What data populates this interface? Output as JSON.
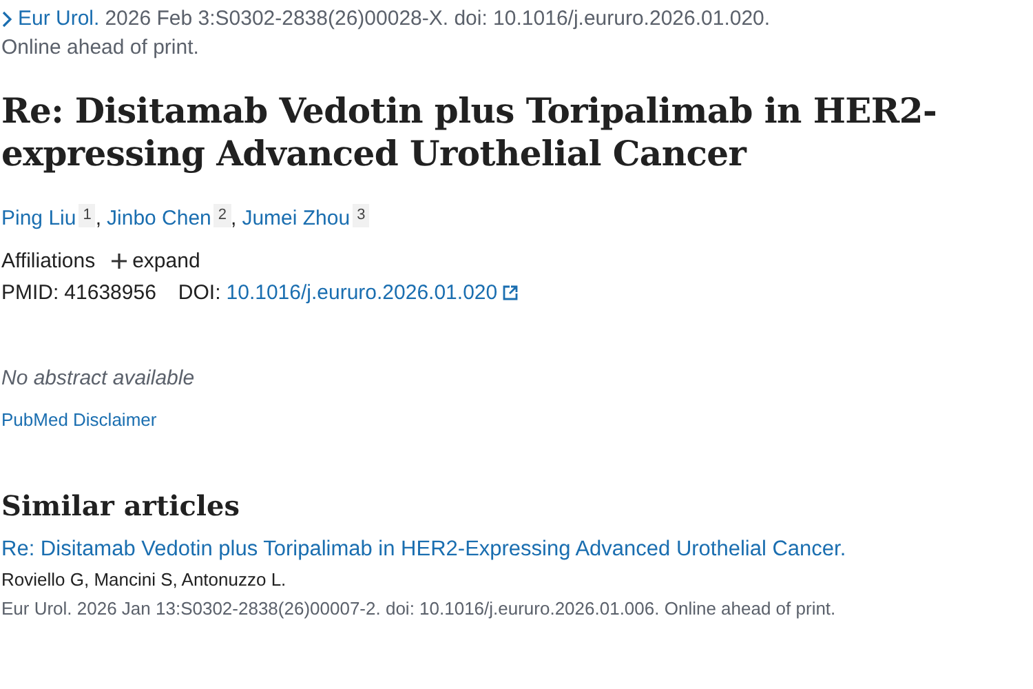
{
  "citation": {
    "journal": "Eur Urol.",
    "details": "2026 Feb 3:S0302-2838(26)00028-X. doi: 10.1016/j.eururo.2026.01.020.",
    "status": "Online ahead of print."
  },
  "title": "Re: Disitamab Vedotin plus Toripalimab in HER2-expressing Advanced Urothelial Cancer",
  "authors": [
    {
      "name": "Ping Liu",
      "affiliation": "1"
    },
    {
      "separator": ",",
      "name": "Jinbo Chen",
      "affiliation": "2"
    },
    {
      "separator": ",",
      "name": "Jumei Zhou",
      "affiliation": "3"
    }
  ],
  "affiliations": {
    "label": "Affiliations",
    "toggle": "expand",
    "expanded": false
  },
  "identifiers": {
    "pmid_label": "PMID:",
    "pmid": "41638956",
    "doi_label": "DOI:",
    "doi": "10.1016/j.eururo.2026.01.020"
  },
  "abstract": "No abstract available",
  "disclaimer": "PubMed Disclaimer",
  "similar_articles": {
    "heading": "Similar articles",
    "items": [
      {
        "title": "Re: Disitamab Vedotin plus Toripalimab in HER2-Expressing Advanced Urothelial Cancer.",
        "authors": "Roviello G, Mancini S, Antonuzzo L.",
        "source": "Eur Urol. 2026 Jan 13:S0302-2838(26)00007-2. doi: 10.1016/j.eururo.2026.01.006. Online ahead of print."
      }
    ]
  }
}
